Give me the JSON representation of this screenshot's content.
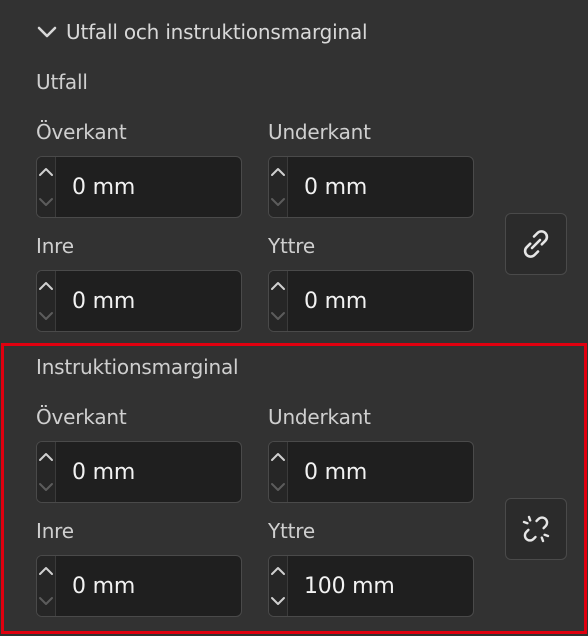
{
  "section": {
    "title": "Utfall och instruktionsmarginal",
    "chevron_icon": "chevron-down-icon",
    "expanded": true
  },
  "bleed": {
    "label": "Utfall",
    "fields": {
      "top": {
        "label": "Överkant",
        "value": "0 mm"
      },
      "bottom": {
        "label": "Underkant",
        "value": "0 mm"
      },
      "inside": {
        "label": "Inre",
        "value": "0 mm"
      },
      "outside": {
        "label": "Yttre",
        "value": "0 mm"
      }
    },
    "link_icon": "link-icon",
    "linked": true
  },
  "slug": {
    "label": "Instruktionsmarginal",
    "fields": {
      "top": {
        "label": "Överkant",
        "value": "0 mm"
      },
      "bottom": {
        "label": "Underkant",
        "value": "0 mm"
      },
      "inside": {
        "label": "Inre",
        "value": "0 mm"
      },
      "outside": {
        "label": "Yttre",
        "value": "100 mm"
      }
    },
    "link_icon": "broken-link-icon",
    "linked": false
  },
  "colors": {
    "panel_background": "#323232",
    "field_background": "#1f1f1f",
    "highlight_border": "#e0000f"
  }
}
